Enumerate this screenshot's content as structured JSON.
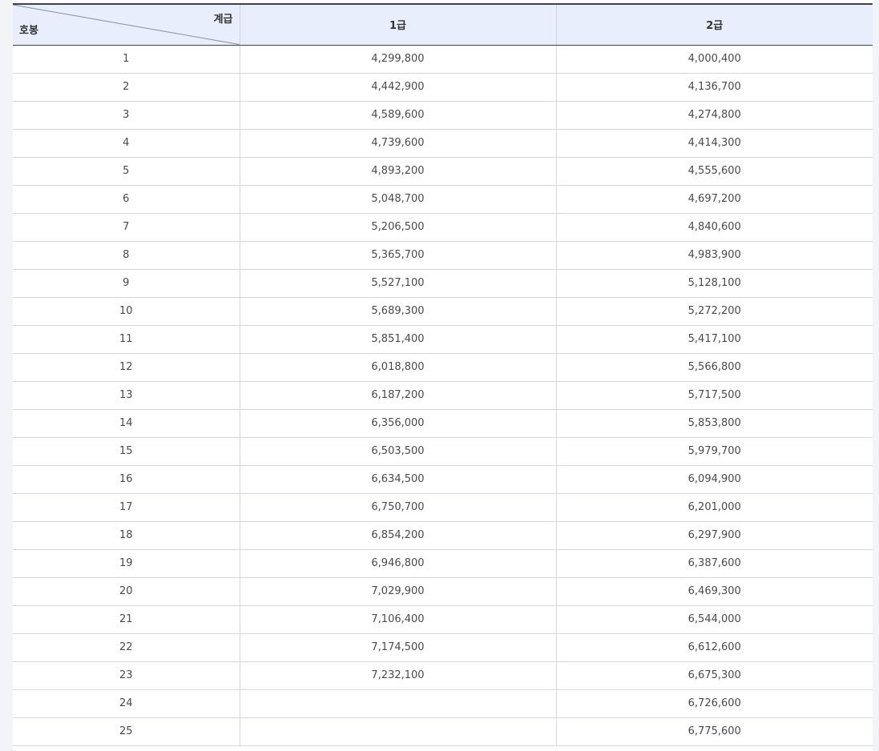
{
  "table": {
    "corner": {
      "column_header": "계급",
      "row_header": "호봉"
    },
    "columns": [
      "1급",
      "2급"
    ],
    "rows": [
      {
        "step": "1",
        "grade1": "4,299,800",
        "grade2": "4,000,400"
      },
      {
        "step": "2",
        "grade1": "4,442,900",
        "grade2": "4,136,700"
      },
      {
        "step": "3",
        "grade1": "4,589,600",
        "grade2": "4,274,800"
      },
      {
        "step": "4",
        "grade1": "4,739,600",
        "grade2": "4,414,300"
      },
      {
        "step": "5",
        "grade1": "4,893,200",
        "grade2": "4,555,600"
      },
      {
        "step": "6",
        "grade1": "5,048,700",
        "grade2": "4,697,200"
      },
      {
        "step": "7",
        "grade1": "5,206,500",
        "grade2": "4,840,600"
      },
      {
        "step": "8",
        "grade1": "5,365,700",
        "grade2": "4,983,900"
      },
      {
        "step": "9",
        "grade1": "5,527,100",
        "grade2": "5,128,100"
      },
      {
        "step": "10",
        "grade1": "5,689,300",
        "grade2": "5,272,200"
      },
      {
        "step": "11",
        "grade1": "5,851,400",
        "grade2": "5,417,100"
      },
      {
        "step": "12",
        "grade1": "6,018,800",
        "grade2": "5,566,800"
      },
      {
        "step": "13",
        "grade1": "6,187,200",
        "grade2": "5,717,500"
      },
      {
        "step": "14",
        "grade1": "6,356,000",
        "grade2": "5,853,800"
      },
      {
        "step": "15",
        "grade1": "6,503,500",
        "grade2": "5,979,700"
      },
      {
        "step": "16",
        "grade1": "6,634,500",
        "grade2": "6,094,900"
      },
      {
        "step": "17",
        "grade1": "6,750,700",
        "grade2": "6,201,000"
      },
      {
        "step": "18",
        "grade1": "6,854,200",
        "grade2": "6,297,900"
      },
      {
        "step": "19",
        "grade1": "6,946,800",
        "grade2": "6,387,600"
      },
      {
        "step": "20",
        "grade1": "7,029,900",
        "grade2": "6,469,300"
      },
      {
        "step": "21",
        "grade1": "7,106,400",
        "grade2": "6,544,000"
      },
      {
        "step": "22",
        "grade1": "7,174,500",
        "grade2": "6,612,600"
      },
      {
        "step": "23",
        "grade1": "7,232,100",
        "grade2": "6,675,300"
      },
      {
        "step": "24",
        "grade1": "",
        "grade2": "6,726,600"
      },
      {
        "step": "25",
        "grade1": "",
        "grade2": "6,775,600"
      }
    ]
  }
}
